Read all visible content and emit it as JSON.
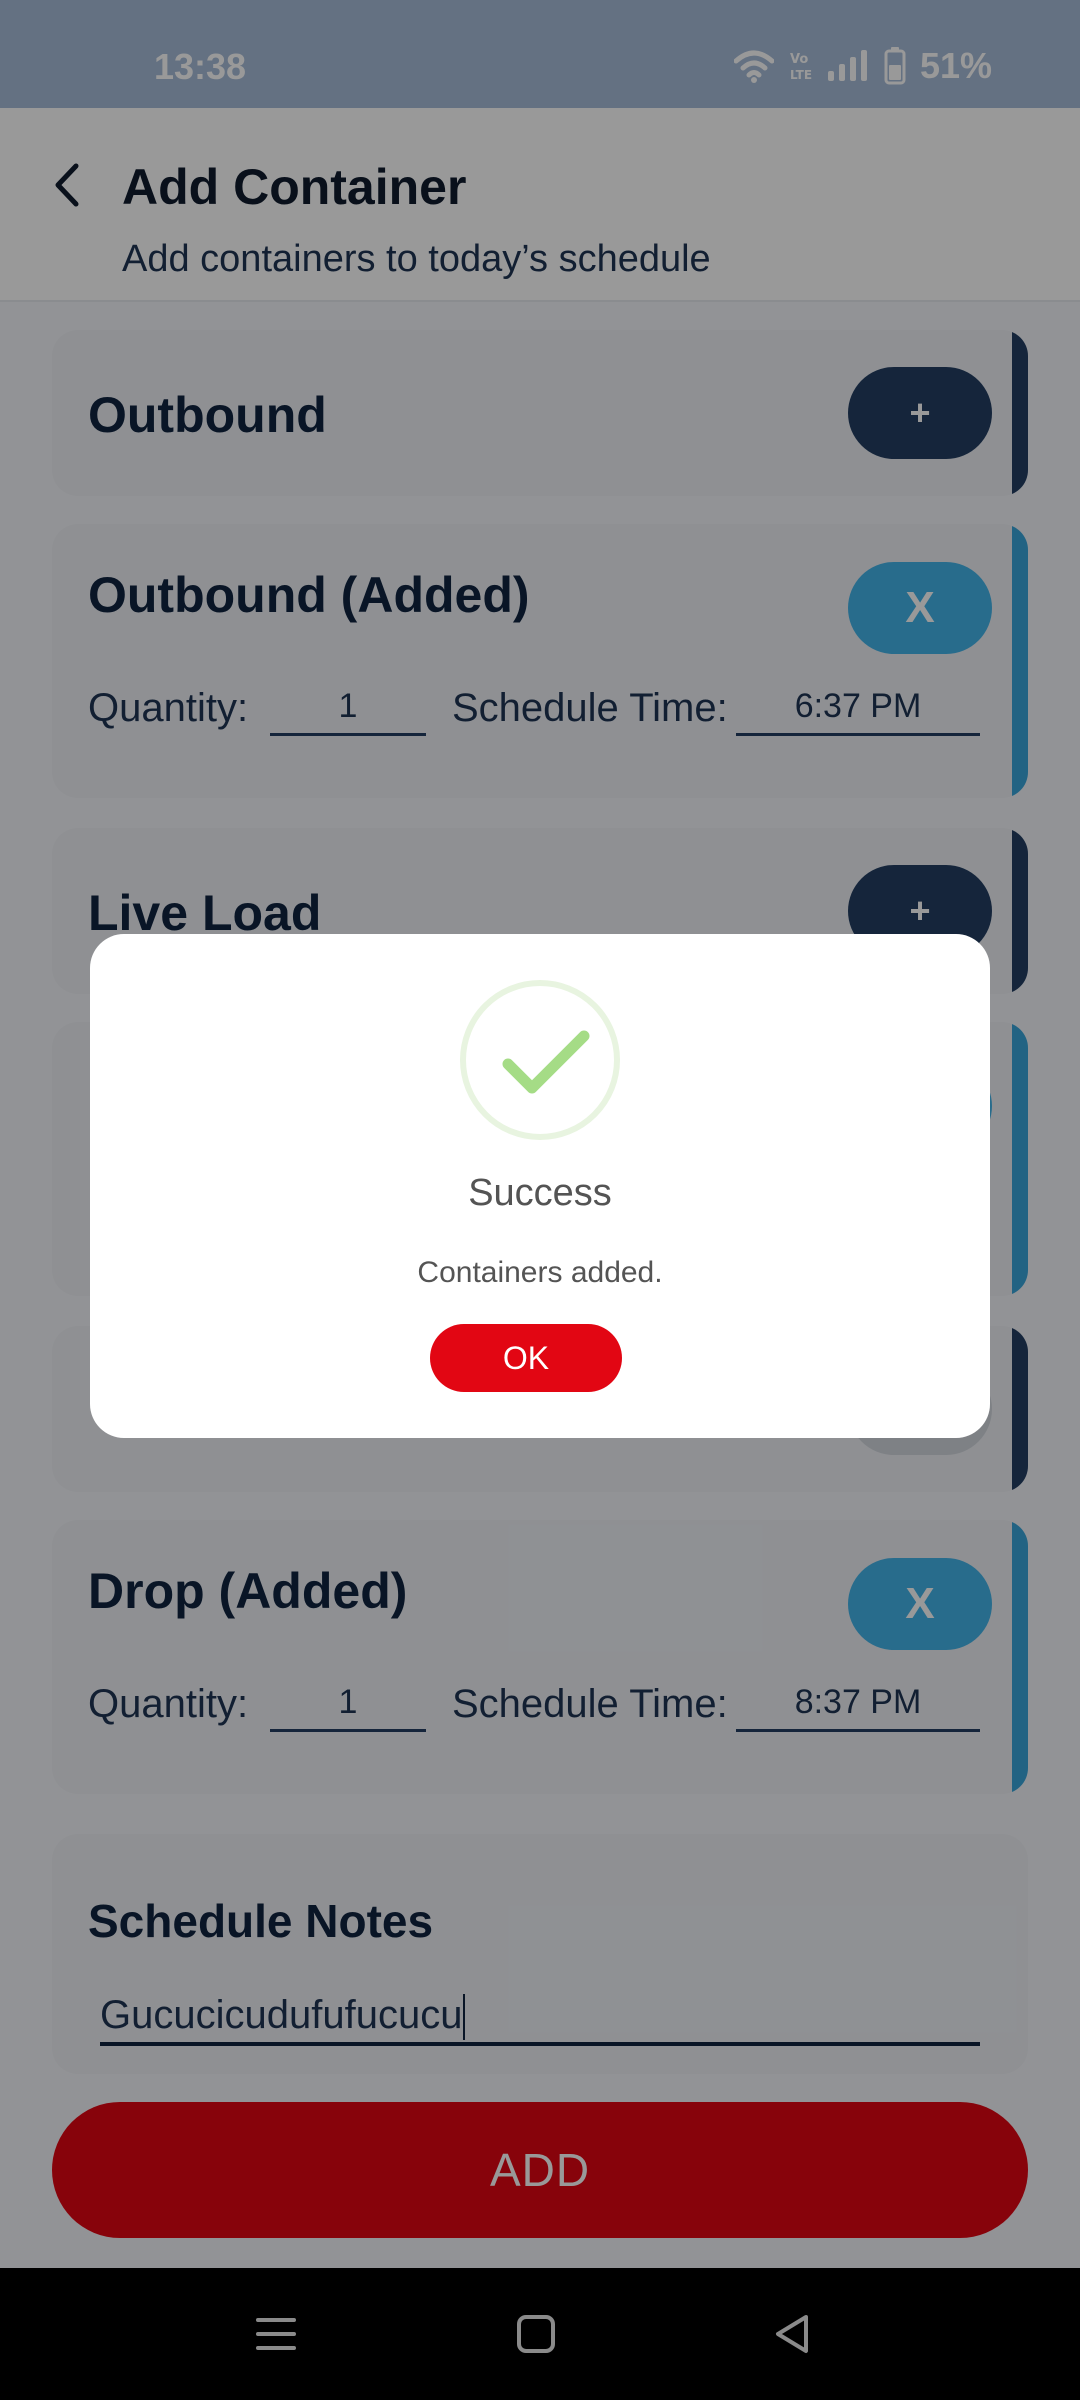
{
  "status_bar": {
    "time": "13:38",
    "battery_percent": "51%",
    "icons": [
      "wifi-icon",
      "volte-icon",
      "signal-icon",
      "battery-icon"
    ]
  },
  "header": {
    "title": "Add Container",
    "subtitle": "Add containers to today’s schedule"
  },
  "cards": {
    "outbound": {
      "title": "Outbound",
      "button": "+"
    },
    "outbound_added": {
      "title": "Outbound (Added)",
      "button": "X",
      "quantity_label": "Quantity:",
      "quantity_value": "1",
      "time_label": "Schedule Time:",
      "time_value": "6:37 PM"
    },
    "live_load": {
      "title": "Live Load",
      "button": "+"
    },
    "drop_added": {
      "title": "Drop (Added)",
      "button": "X",
      "quantity_label": "Quantity:",
      "quantity_value": "1",
      "time_label": "Schedule Time:",
      "time_value": "8:37 PM"
    }
  },
  "notes": {
    "title": "Schedule Notes",
    "value": "Gucucicudufufucucu"
  },
  "add_button": "ADD",
  "dialog": {
    "title": "Success",
    "message": "Containers added.",
    "ok_label": "OK"
  },
  "colors": {
    "accent_dark": "#233f63",
    "accent_blue": "#3aa6da",
    "primary_red": "#e20613",
    "success_green": "#a5dc86"
  }
}
